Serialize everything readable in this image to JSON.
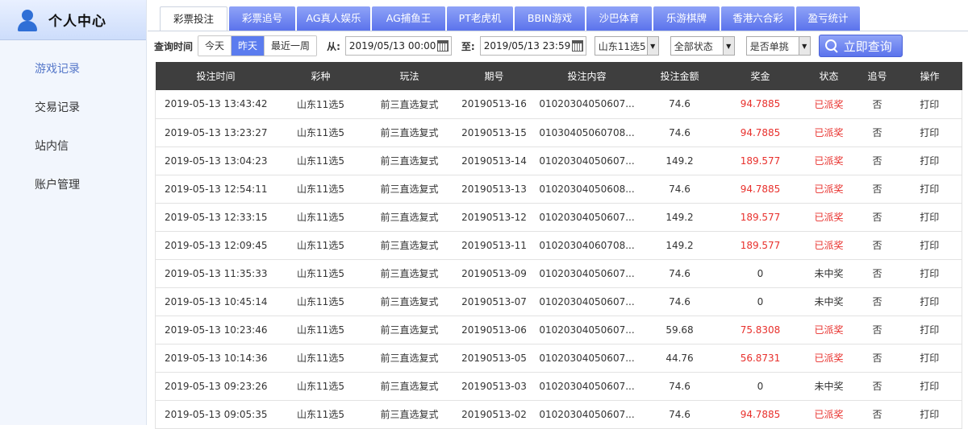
{
  "sidebar": {
    "title": "个人中心",
    "items": [
      {
        "label": "游戏记录",
        "active": true
      },
      {
        "label": "交易记录",
        "active": false
      },
      {
        "label": "站内信",
        "active": false
      },
      {
        "label": "账户管理",
        "active": false
      }
    ]
  },
  "tabs": [
    {
      "label": "彩票投注",
      "active": true
    },
    {
      "label": "彩票追号",
      "active": false
    },
    {
      "label": "AG真人娱乐",
      "active": false
    },
    {
      "label": "AG捕鱼王",
      "active": false
    },
    {
      "label": "PT老虎机",
      "active": false
    },
    {
      "label": "BBIN游戏",
      "active": false
    },
    {
      "label": "沙巴体育",
      "active": false
    },
    {
      "label": "乐游棋牌",
      "active": false
    },
    {
      "label": "香港六合彩",
      "active": false
    },
    {
      "label": "盈亏统计",
      "active": false
    }
  ],
  "filter": {
    "time_label": "查询时间",
    "range_options": [
      {
        "label": "今天",
        "active": false
      },
      {
        "label": "昨天",
        "active": true
      },
      {
        "label": "最近一周",
        "active": false
      }
    ],
    "from_label": "从:",
    "from_value": "2019/05/13 00:00",
    "to_label": "至:",
    "to_value": "2019/05/13 23:59",
    "lottery_select": "山东11选5",
    "status_select": "全部状态",
    "single_select": "是否单挑",
    "query_button": "立即查询"
  },
  "colors": {
    "accent": "#5b73ec",
    "header_bg": "#3e3e3e",
    "win_red": "#e8302c"
  },
  "table": {
    "headers": [
      "投注时间",
      "彩种",
      "玩法",
      "期号",
      "投注内容",
      "投注金额",
      "奖金",
      "状态",
      "追号",
      "操作"
    ],
    "rows": [
      {
        "time": "2019-05-13 13:43:42",
        "lottery": "山东11选5",
        "play": "前三直选复式",
        "issue": "20190513-16",
        "content": "01020304050607...",
        "amount": "74.6",
        "prize": "94.7885",
        "status": "已派奖",
        "chase": "否",
        "action": "打印",
        "won": true
      },
      {
        "time": "2019-05-13 13:23:27",
        "lottery": "山东11选5",
        "play": "前三直选复式",
        "issue": "20190513-15",
        "content": "01030405060708...",
        "amount": "74.6",
        "prize": "94.7885",
        "status": "已派奖",
        "chase": "否",
        "action": "打印",
        "won": true
      },
      {
        "time": "2019-05-13 13:04:23",
        "lottery": "山东11选5",
        "play": "前三直选复式",
        "issue": "20190513-14",
        "content": "01020304050607...",
        "amount": "149.2",
        "prize": "189.577",
        "status": "已派奖",
        "chase": "否",
        "action": "打印",
        "won": true
      },
      {
        "time": "2019-05-13 12:54:11",
        "lottery": "山东11选5",
        "play": "前三直选复式",
        "issue": "20190513-13",
        "content": "01020304050608...",
        "amount": "74.6",
        "prize": "94.7885",
        "status": "已派奖",
        "chase": "否",
        "action": "打印",
        "won": true
      },
      {
        "time": "2019-05-13 12:33:15",
        "lottery": "山东11选5",
        "play": "前三直选复式",
        "issue": "20190513-12",
        "content": "01020304050607...",
        "amount": "149.2",
        "prize": "189.577",
        "status": "已派奖",
        "chase": "否",
        "action": "打印",
        "won": true
      },
      {
        "time": "2019-05-13 12:09:45",
        "lottery": "山东11选5",
        "play": "前三直选复式",
        "issue": "20190513-11",
        "content": "01020304060708...",
        "amount": "149.2",
        "prize": "189.577",
        "status": "已派奖",
        "chase": "否",
        "action": "打印",
        "won": true
      },
      {
        "time": "2019-05-13 11:35:33",
        "lottery": "山东11选5",
        "play": "前三直选复式",
        "issue": "20190513-09",
        "content": "01020304050607...",
        "amount": "74.6",
        "prize": "0",
        "status": "未中奖",
        "chase": "否",
        "action": "打印",
        "won": false
      },
      {
        "time": "2019-05-13 10:45:14",
        "lottery": "山东11选5",
        "play": "前三直选复式",
        "issue": "20190513-07",
        "content": "01020304050607...",
        "amount": "74.6",
        "prize": "0",
        "status": "未中奖",
        "chase": "否",
        "action": "打印",
        "won": false
      },
      {
        "time": "2019-05-13 10:23:46",
        "lottery": "山东11选5",
        "play": "前三直选复式",
        "issue": "20190513-06",
        "content": "01020304050607...",
        "amount": "59.68",
        "prize": "75.8308",
        "status": "已派奖",
        "chase": "否",
        "action": "打印",
        "won": true
      },
      {
        "time": "2019-05-13 10:14:36",
        "lottery": "山东11选5",
        "play": "前三直选复式",
        "issue": "20190513-05",
        "content": "01020304050607...",
        "amount": "44.76",
        "prize": "56.8731",
        "status": "已派奖",
        "chase": "否",
        "action": "打印",
        "won": true
      },
      {
        "time": "2019-05-13 09:23:26",
        "lottery": "山东11选5",
        "play": "前三直选复式",
        "issue": "20190513-03",
        "content": "01020304050607...",
        "amount": "74.6",
        "prize": "0",
        "status": "未中奖",
        "chase": "否",
        "action": "打印",
        "won": false
      },
      {
        "time": "2019-05-13 09:05:35",
        "lottery": "山东11选5",
        "play": "前三直选复式",
        "issue": "20190513-02",
        "content": "01020304050607...",
        "amount": "74.6",
        "prize": "94.7885",
        "status": "已派奖",
        "chase": "否",
        "action": "打印",
        "won": true
      }
    ]
  }
}
